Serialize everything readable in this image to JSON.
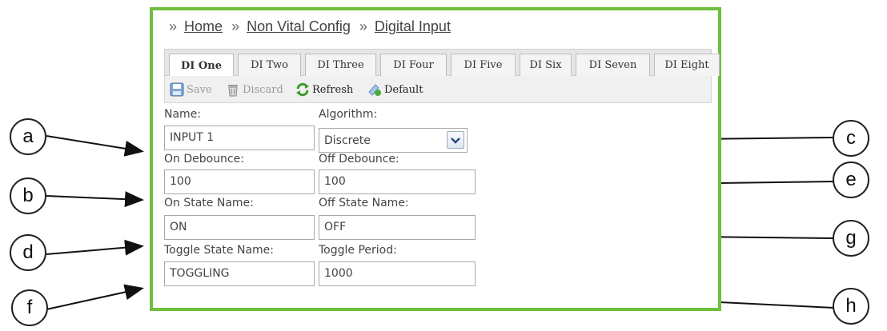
{
  "breadcrumb": {
    "separator": "»",
    "items": [
      "Home",
      "Non Vital Config",
      "Digital Input"
    ]
  },
  "tabs": [
    "DI One",
    "DI Two",
    "DI Three",
    "DI Four",
    "DI Five",
    "DI Six",
    "DI Seven",
    "DI Eight"
  ],
  "active_tab": "DI One",
  "toolbar": {
    "save": "Save",
    "discard": "Discard",
    "refresh": "Refresh",
    "default": "Default"
  },
  "form": {
    "name": {
      "label": "Name:",
      "value": "INPUT 1"
    },
    "algorithm": {
      "label": "Algorithm:",
      "value": "Discrete"
    },
    "on_debounce": {
      "label": "On Debounce:",
      "value": "100"
    },
    "off_debounce": {
      "label": "Off Debounce:",
      "value": "100"
    },
    "on_state_name": {
      "label": "On State Name:",
      "value": "ON"
    },
    "off_state_name": {
      "label": "Off State Name:",
      "value": "OFF"
    },
    "toggle_state_name": {
      "label": "Toggle State Name:",
      "value": "TOGGLING"
    },
    "toggle_period": {
      "label": "Toggle Period:",
      "value": "1000"
    }
  },
  "callouts": {
    "a": "a",
    "b": "b",
    "c": "c",
    "d": "d",
    "e": "e",
    "f": "f",
    "g": "g",
    "h": "h"
  },
  "colors": {
    "frame": "#6fbe3f",
    "refresh_icon": "#3a9a2a",
    "save_icon": "#5a8fd0"
  }
}
